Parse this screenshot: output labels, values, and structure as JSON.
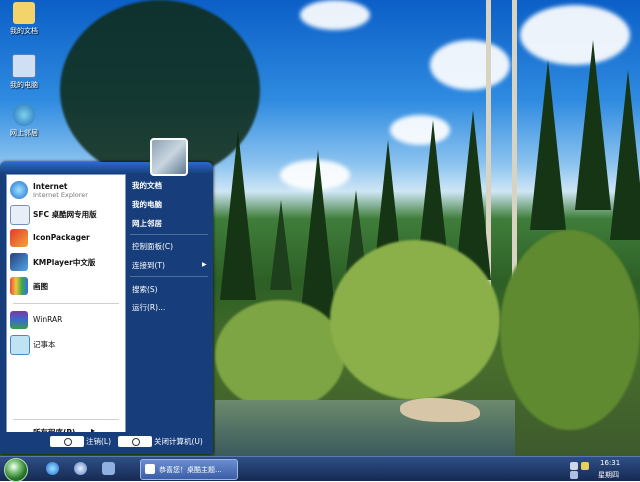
{
  "desktop": {
    "icons": [
      {
        "label": "我的文档",
        "icon": "folder-icon"
      },
      {
        "label": "我的电脑",
        "icon": "computer-icon"
      },
      {
        "label": "网上邻居",
        "icon": "network-icon"
      }
    ]
  },
  "start_menu": {
    "pinned": [
      {
        "title": "Internet",
        "subtitle": "Internet Explorer",
        "icon": "internet-explorer-icon"
      },
      {
        "title": "SFC 桌酷网专用版",
        "icon": "sfc-icon"
      },
      {
        "title": "IconPackager",
        "icon": "iconpackager-icon"
      },
      {
        "title": "KMPlayer中文版",
        "icon": "kmplayer-icon"
      },
      {
        "title": "画图",
        "icon": "paint-icon"
      }
    ],
    "recent": [
      {
        "title": "WinRAR",
        "icon": "winrar-icon"
      },
      {
        "title": "记事本",
        "icon": "notepad-icon"
      }
    ],
    "all_programs": "所有程序(P)",
    "right": {
      "my_documents": "我的文档",
      "my_computer": "我的电脑",
      "network": "网上邻居",
      "control_panel": "控制面板(C)",
      "connect_to": "连接到(T)",
      "search": "搜索(S)",
      "run": "运行(R)..."
    },
    "logoff": "注销(L)",
    "shutdown": "关闭计算机(U)"
  },
  "taskbar": {
    "task_label": "恭喜您！桌酷主题...",
    "time": "16:31",
    "weekday": "星期四"
  },
  "colors": {
    "menu_blue": "#173e7a",
    "taskbar": "#1e3766"
  }
}
